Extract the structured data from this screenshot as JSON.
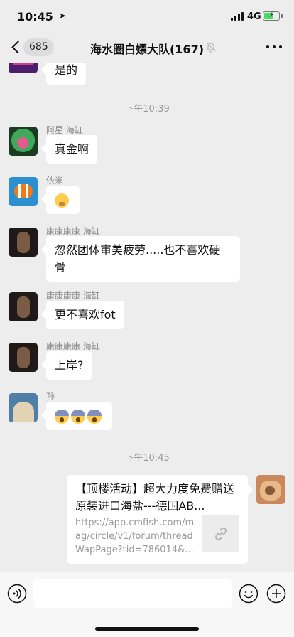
{
  "status_bar": {
    "time": "10:45",
    "network": "4G"
  },
  "nav": {
    "unread_count": "685",
    "title": "海水圈白嫖大队(167)"
  },
  "messages": [
    {
      "text": "是的"
    },
    {
      "time": "下午10:39"
    },
    {
      "sender": "阿星 海缸",
      "text": "真金啊"
    },
    {
      "sender": "依米"
    },
    {
      "sender": "康康康康 海缸",
      "text": "忽然团体审美疲劳.....也不喜欢硬骨"
    },
    {
      "sender": "康康康康 海缸",
      "text": "更不喜欢fot"
    },
    {
      "sender": "康康康康 海缸",
      "text": "上岸?"
    },
    {
      "sender": "孙"
    },
    {
      "time": "下午10:45"
    }
  ],
  "link_card": {
    "title": "【顶楼活动】超大力度免费赠送原装进口海盐---德国AB...",
    "url": "https://app.cmfish.com/mag/circle/v1/forum/threadWapPage?tid=786014&..."
  },
  "icons": {
    "voice": "voice-icon",
    "emoji": "emoji-icon",
    "plus": "plus-icon",
    "link": "link-icon",
    "mute": "mute-bell-icon"
  },
  "colors": {
    "background": "#ededed",
    "bubble": "#ffffff",
    "battery": "#4cd964"
  }
}
